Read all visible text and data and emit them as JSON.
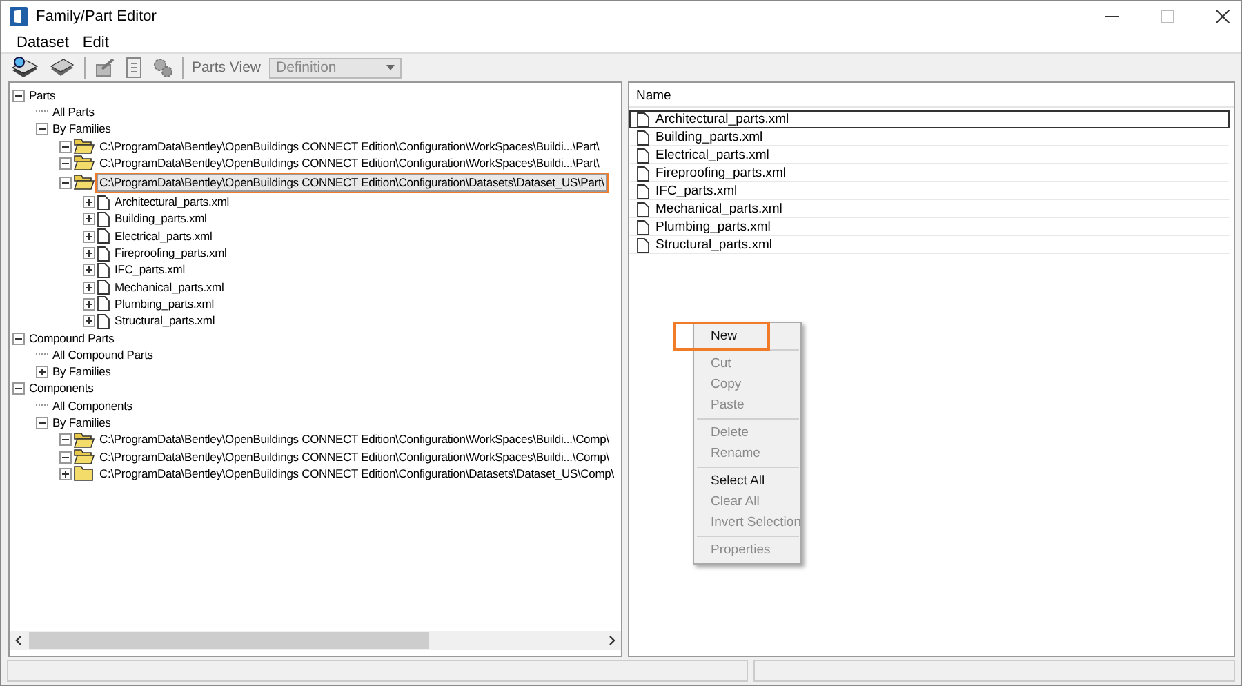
{
  "window": {
    "title": "Family/Part Editor"
  },
  "menu": [
    {
      "label": "Dataset"
    },
    {
      "label": "Edit"
    }
  ],
  "toolbar": {
    "view_label": "Parts View",
    "view_value": "Definition",
    "view_disabled": true
  },
  "tree": [
    {
      "label": "Parts",
      "expanded": true,
      "children": [
        {
          "label": "All Parts"
        },
        {
          "label": "By Families",
          "expanded": true,
          "children": [
            {
              "label": "C:\\ProgramData\\Bentley\\OpenBuildings CONNECT Edition\\Configuration\\WorkSpaces\\Buildi...\\Part\\",
              "kind": "folder",
              "expanded": true,
              "selected": false,
              "callout": false
            },
            {
              "label": "C:\\ProgramData\\Bentley\\OpenBuildings CONNECT Edition\\Configuration\\WorkSpaces\\Buildi...\\Part\\",
              "kind": "folder",
              "expanded": true,
              "selected": false,
              "callout": false
            },
            {
              "label": "C:\\ProgramData\\Bentley\\OpenBuildings CONNECT Edition\\Configuration\\Datasets\\Dataset_US\\Part\\",
              "kind": "folder",
              "expanded": true,
              "selected": true,
              "callout": true,
              "children": [
                {
                  "label": "Architectural_parts.xml",
                  "kind": "file",
                  "expanded": false
                },
                {
                  "label": "Building_parts.xml",
                  "kind": "file",
                  "expanded": false
                },
                {
                  "label": "Electrical_parts.xml",
                  "kind": "file",
                  "expanded": false
                },
                {
                  "label": "Fireproofing_parts.xml",
                  "kind": "file",
                  "expanded": false
                },
                {
                  "label": "IFC_parts.xml",
                  "kind": "file",
                  "expanded": false
                },
                {
                  "label": "Mechanical_parts.xml",
                  "kind": "file",
                  "expanded": false
                },
                {
                  "label": "Plumbing_parts.xml",
                  "kind": "file",
                  "expanded": false
                },
                {
                  "label": "Structural_parts.xml",
                  "kind": "file",
                  "expanded": false
                }
              ]
            }
          ]
        }
      ]
    },
    {
      "label": "Compound Parts",
      "expanded": true,
      "children": [
        {
          "label": "All Compound Parts"
        },
        {
          "label": "By Families",
          "expanded": false
        }
      ]
    },
    {
      "label": "Components",
      "expanded": true,
      "children": [
        {
          "label": "All Components"
        },
        {
          "label": "By Families",
          "expanded": true,
          "children": [
            {
              "label": "C:\\ProgramData\\Bentley\\OpenBuildings CONNECT Edition\\Configuration\\WorkSpaces\\Buildi...\\Comp\\",
              "kind": "folder",
              "expanded": true,
              "selected": false,
              "callout": false
            },
            {
              "label": "C:\\ProgramData\\Bentley\\OpenBuildings CONNECT Edition\\Configuration\\WorkSpaces\\Buildi...\\Comp\\",
              "kind": "folder",
              "expanded": true,
              "selected": false,
              "callout": false
            },
            {
              "label": "C:\\ProgramData\\Bentley\\OpenBuildings CONNECT Edition\\Configuration\\Datasets\\Dataset_US\\Comp\\",
              "kind": "folder",
              "expanded": false,
              "selected": false,
              "callout": false
            }
          ]
        }
      ]
    }
  ],
  "list": {
    "column": "Name",
    "rows": [
      {
        "name": "Architectural_parts.xml",
        "focused": true
      },
      {
        "name": "Building_parts.xml",
        "focused": false
      },
      {
        "name": "Electrical_parts.xml",
        "focused": false
      },
      {
        "name": "Fireproofing_parts.xml",
        "focused": false
      },
      {
        "name": "IFC_parts.xml",
        "focused": false
      },
      {
        "name": "Mechanical_parts.xml",
        "focused": false
      },
      {
        "name": "Plumbing_parts.xml",
        "focused": false
      },
      {
        "name": "Structural_parts.xml",
        "focused": false
      }
    ]
  },
  "context_menu": [
    {
      "kind": "item",
      "label": "New",
      "disabled": false,
      "callout": true
    },
    {
      "kind": "separator"
    },
    {
      "kind": "item",
      "label": "Cut",
      "disabled": true,
      "callout": false
    },
    {
      "kind": "item",
      "label": "Copy",
      "disabled": true,
      "callout": false
    },
    {
      "kind": "item",
      "label": "Paste",
      "disabled": true,
      "callout": false
    },
    {
      "kind": "separator"
    },
    {
      "kind": "item",
      "label": "Delete",
      "disabled": true,
      "callout": false
    },
    {
      "kind": "item",
      "label": "Rename",
      "disabled": true,
      "callout": false
    },
    {
      "kind": "separator"
    },
    {
      "kind": "item",
      "label": "Select All",
      "disabled": false,
      "callout": false
    },
    {
      "kind": "item",
      "label": "Clear All",
      "disabled": true,
      "callout": false
    },
    {
      "kind": "item",
      "label": "Invert Selection",
      "disabled": true,
      "callout": false
    },
    {
      "kind": "separator"
    },
    {
      "kind": "item",
      "label": "Properties",
      "disabled": true,
      "callout": false
    }
  ]
}
